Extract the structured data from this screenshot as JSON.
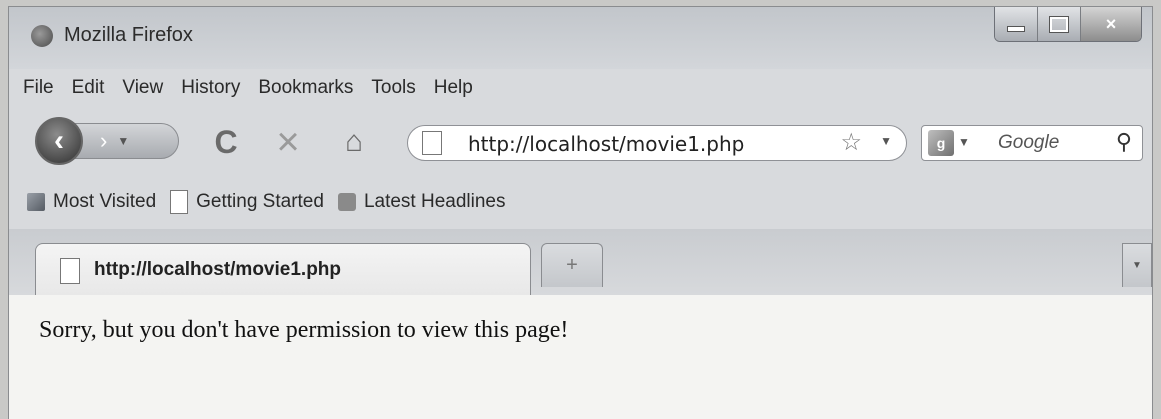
{
  "window": {
    "title": "Mozilla Firefox",
    "controls": {
      "minimize": "",
      "maximize": "",
      "close": "×"
    }
  },
  "menu": [
    "File",
    "Edit",
    "View",
    "History",
    "Bookmarks",
    "Tools",
    "Help"
  ],
  "toolbar": {
    "back_glyph": "‹",
    "forward_glyph": "›",
    "reload_glyph": "C",
    "stop_glyph": "×",
    "home_glyph": "⌂",
    "url": "http://localhost/movie1.php",
    "star_glyph": "☆",
    "dropdown_glyph": "▼",
    "search_placeholder": "Google",
    "search_glyph": "⚲"
  },
  "bookmarks": [
    "Most Visited",
    "Getting Started",
    "Latest Headlines"
  ],
  "tabs": [
    {
      "title": "http://localhost/movie1.php",
      "active": true
    }
  ],
  "newtab_glyph": "+",
  "page": {
    "message": "Sorry, but you don't have permission to view this page!"
  },
  "colors": {
    "chrome": "#d8dadd",
    "content_bg": "#f4f4f2"
  }
}
